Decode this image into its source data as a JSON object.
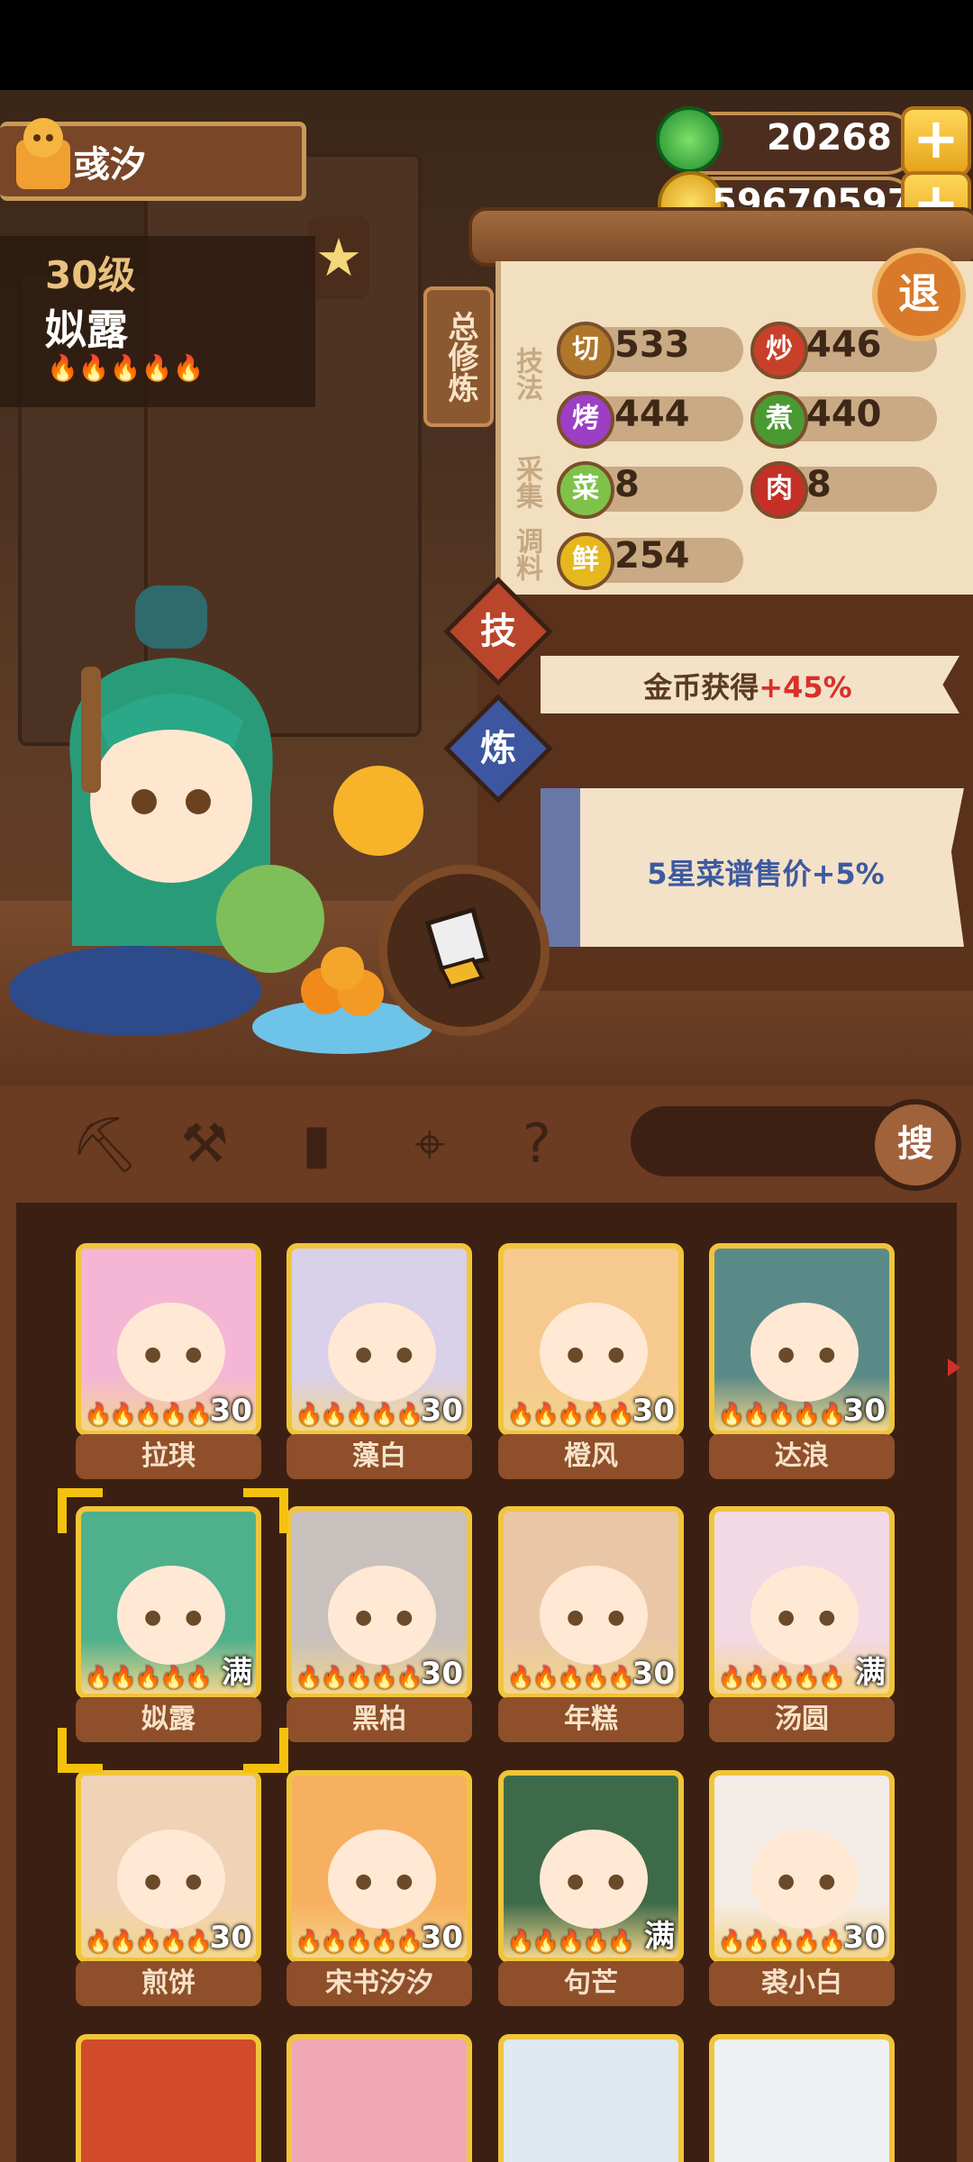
{
  "player": {
    "name": "彧汐"
  },
  "currency": {
    "jade": "20268",
    "coins": "59670597",
    "plus_label": "+"
  },
  "chef": {
    "level": "30级",
    "name": "姒露"
  },
  "scroll": {
    "total_label": "总修炼",
    "technique_label": "技法",
    "gather_label": "采集",
    "season_label": "调料",
    "stats": [
      {
        "icon": "切",
        "value": "533"
      },
      {
        "icon": "炒",
        "value": "446"
      },
      {
        "icon": "烤",
        "value": "444"
      },
      {
        "icon": "煮",
        "value": "440"
      },
      {
        "icon": "菜",
        "value": "8"
      },
      {
        "icon": "肉",
        "value": "8"
      },
      {
        "icon": "鲜",
        "value": "254"
      }
    ],
    "exit_label": "退"
  },
  "skill_btn": "技",
  "refine_btn": "炼",
  "bonus1": {
    "text": "金币获得",
    "value": "+45%"
  },
  "bonus2": {
    "star": "5",
    "text": "星菜谱售价",
    "value": "+5%"
  },
  "toolbar": {
    "search_label": "搜"
  },
  "chefs": [
    {
      "name": "拉琪",
      "level": "30",
      "color": "#f4b6d4"
    },
    {
      "name": "藻白",
      "level": "30",
      "color": "#d9d0ea"
    },
    {
      "name": "橙风",
      "level": "30",
      "color": "#f6c98e"
    },
    {
      "name": "达浪",
      "level": "30",
      "color": "#5a8a88"
    },
    {
      "name": "姒露",
      "level": "满",
      "color": "#4fb08c"
    },
    {
      "name": "黑柏",
      "level": "30",
      "color": "#c8c0bc"
    },
    {
      "name": "年糕",
      "level": "30",
      "color": "#e9c7a6"
    },
    {
      "name": "汤圆",
      "level": "满",
      "color": "#f3d9e4"
    },
    {
      "name": "煎饼",
      "level": "30",
      "color": "#f0d3b6"
    },
    {
      "name": "宋书汐汐",
      "level": "30",
      "color": "#f7b060"
    },
    {
      "name": "句芒",
      "level": "满",
      "color": "#3d6b4a"
    },
    {
      "name": "裘小白",
      "level": "30",
      "color": "#f4ece6"
    }
  ],
  "flames": "🔥🔥🔥🔥🔥"
}
